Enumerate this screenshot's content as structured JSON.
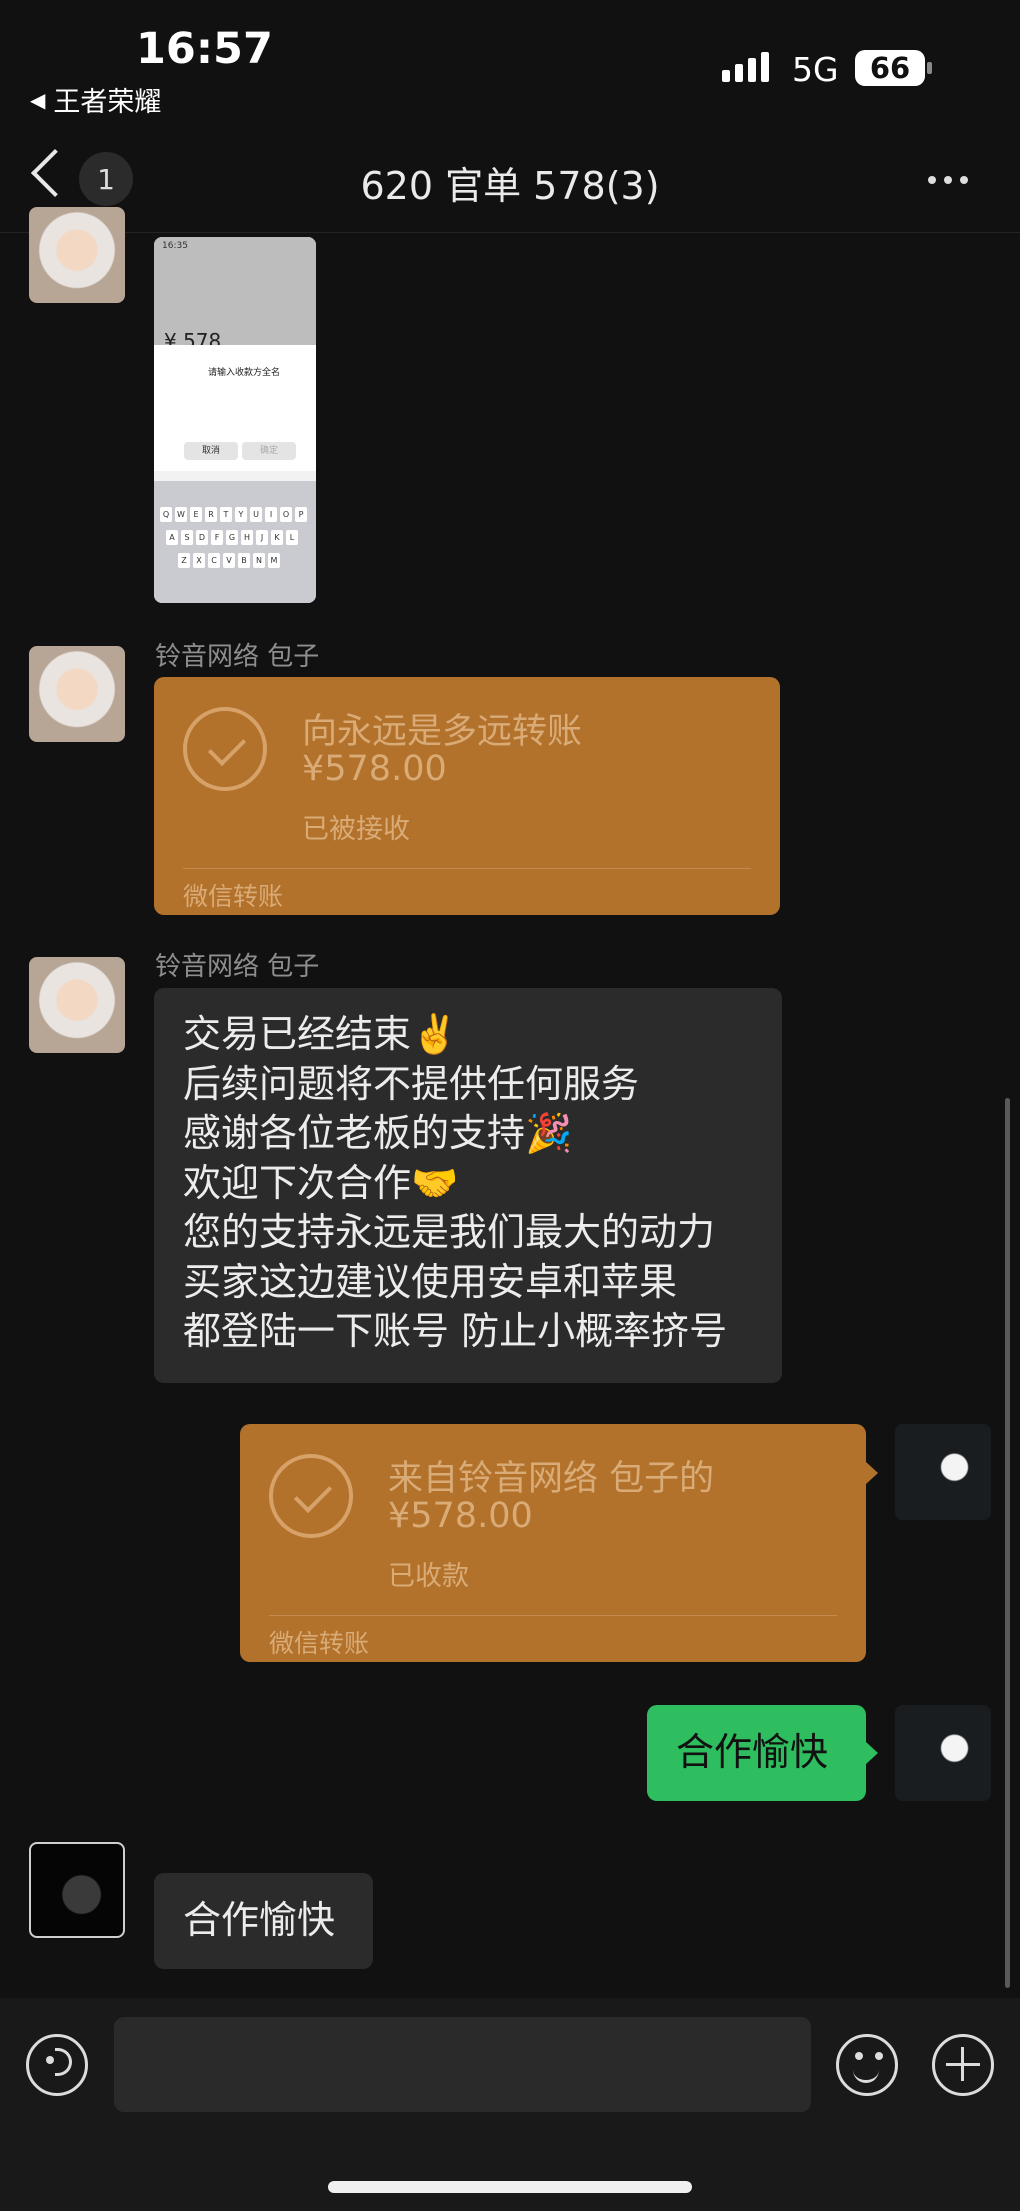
{
  "status_bar": {
    "time": "16:57",
    "back_app": "王者荣耀",
    "network": "5G",
    "battery": "66"
  },
  "nav": {
    "unread_count": "1",
    "title": "620 官单 578(3)"
  },
  "image_message": {
    "inner_time": "16:35",
    "inner_amount": "¥ 578",
    "inner_dialog_title": "请输入收款方全名",
    "inner_cancel": "取消",
    "inner_confirm": "确定",
    "keyboard_rows": [
      "QWERTYUIOP",
      "ASDFGHJKL",
      "ZXCVBNM"
    ]
  },
  "messages": [
    {
      "sender": "铃音网络 包子",
      "type": "transfer",
      "title": "向永远是多远转账",
      "amount": "¥578.00",
      "status": "已被接收",
      "footer": "微信转账"
    },
    {
      "sender": "铃音网络 包子",
      "type": "text",
      "text": "交易已经结束✌️\n后续问题将不提供任何服务\n感谢各位老板的支持🎉\n欢迎下次合作🤝\n您的支持永远是我们最大的动力\n买家这边建议使用安卓和苹果\n都登陆一下账号 防止小概率挤号"
    },
    {
      "type": "transfer",
      "title": "来自铃音网络 包子的",
      "amount": "¥578.00",
      "status": "已收款",
      "footer": "微信转账"
    },
    {
      "type": "text",
      "text": "合作愉快"
    },
    {
      "type": "text",
      "text": "合作愉快"
    }
  ],
  "colors": {
    "background": "#111111",
    "transfer_card": "#b3722b",
    "sent_bubble": "#2ebd5f",
    "received_bubble": "#2b2b2b"
  }
}
